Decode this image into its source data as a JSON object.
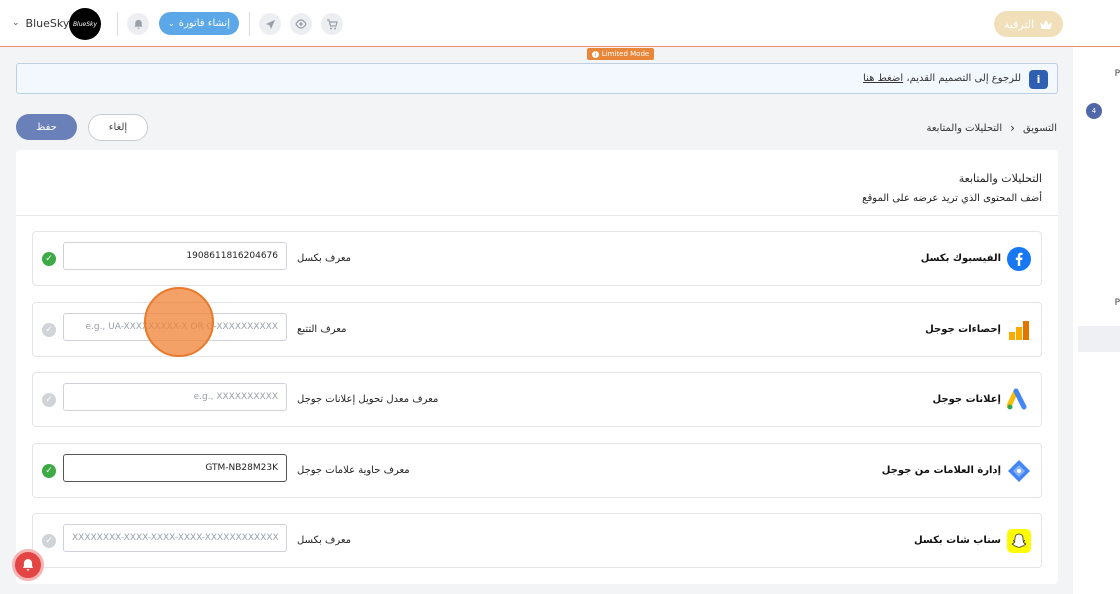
{
  "topbar": {
    "store_name": "BlueSky",
    "logo_text": "BlueSky",
    "create_invoice_label": "إنشاء فاتورة",
    "upgrade_label": "الترقية"
  },
  "limited_mode_label": "Limited Mode",
  "notice": {
    "text": "للرجوع إلى التصميم القديم،",
    "link": "اضغط هنا"
  },
  "actions": {
    "save_label": "حفظ",
    "cancel_label": "إلغاء"
  },
  "breadcrumb": {
    "parent": "التسويق",
    "current": "التحليلات والمتابعة"
  },
  "section": {
    "title": "التحليلات والمتابعة",
    "subtitle": "أضف المحتوى الذي تريد عرضه على الموقع"
  },
  "right_panel": {
    "badge": "4",
    "letter1": "P",
    "letter2": "P"
  },
  "integrations": [
    {
      "name": "الفيسبوك بكسل",
      "field_label": "معرف بكسل",
      "value": "1908611816204676",
      "placeholder": "",
      "active": true,
      "icon": "facebook-icon"
    },
    {
      "name": "إحصاءات جوجل",
      "field_label": "معرف التتبع",
      "value": "",
      "placeholder": "e.g., UA-XXXXXXXXX-X OR G-XXXXXXXXXX",
      "active": false,
      "icon": "google-analytics-icon"
    },
    {
      "name": "إعلانات جوجل",
      "field_label": "معرف معدل تحويل إعلانات جوجل",
      "value": "",
      "placeholder": "e.g., XXXXXXXXXX",
      "active": false,
      "icon": "google-ads-icon"
    },
    {
      "name": "إدارة العلامات من جوجل",
      "field_label": "معرف حاوية علامات جوجل",
      "value": "GTM-NB28M23K",
      "placeholder": "",
      "active": true,
      "icon": "google-tag-manager-icon"
    },
    {
      "name": "سناب شات بكسل",
      "field_label": "معرف بكسل",
      "value": "",
      "placeholder": "XXXXXXXX-XXXX-XXXX-XXXX-XXXXXXXXXXXX ,",
      "active": false,
      "icon": "snapchat-icon"
    }
  ],
  "colors": {
    "primary": "#6a80b8",
    "success": "#3daa46",
    "accent_orange": "#e8873a"
  }
}
